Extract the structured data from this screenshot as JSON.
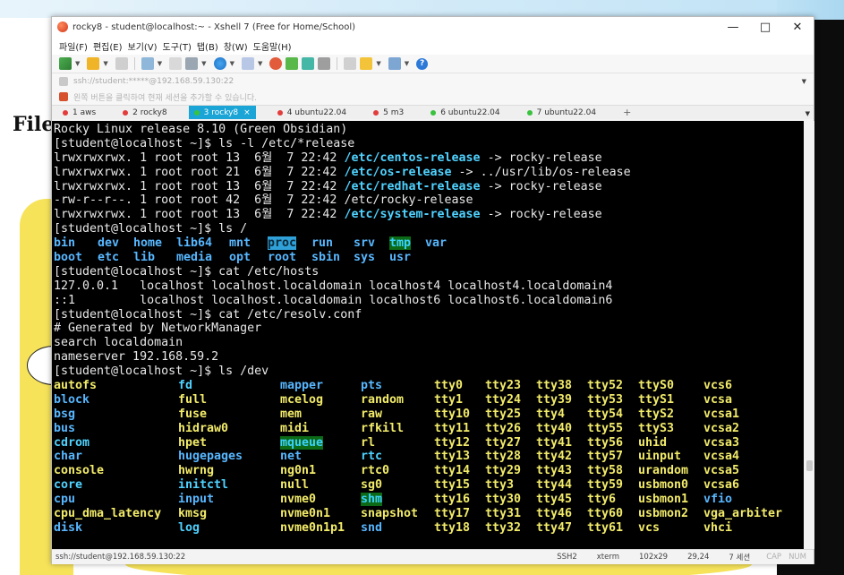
{
  "window": {
    "title": "rocky8 - student@localhost:~ - Xshell 7 (Free for Home/School)"
  },
  "background": {
    "title_fragment": "File"
  },
  "menubar": {
    "items": [
      "파일(F)",
      "편집(E)",
      "보기(V)",
      "도구(T)",
      "탭(B)",
      "창(W)",
      "도움말(H)"
    ]
  },
  "addressbar": {
    "text": "ssh://student:*****@192.168.59.130:22"
  },
  "infobar": {
    "text": "왼쪽 버튼을 클릭하여 현재 세션을 추가할 수 있습니다."
  },
  "tabs": [
    {
      "label": "1 aws",
      "color": "#e23c3c"
    },
    {
      "label": "2 rocky8",
      "color": "#e23c3c"
    },
    {
      "label": "3 rocky8",
      "color": "#38c23d",
      "active": true
    },
    {
      "label": "4 ubuntu22.04",
      "color": "#e23c3c"
    },
    {
      "label": "5 m3",
      "color": "#e23c3c"
    },
    {
      "label": "6 ubuntu22.04",
      "color": "#38c23d"
    },
    {
      "label": "7 ubuntu22.04",
      "color": "#38c23d"
    }
  ],
  "tab_add": "+",
  "terminal": {
    "line0": "Rocky Linux release 8.10 (Green Obsidian)",
    "cmd1": "[student@localhost ~]$ ls -l /etc/*release",
    "rel": [
      {
        "prefix": "lrwxrwxrwx. 1 root root 13  6월  7 22:42 ",
        "name": "/etc/centos-release",
        "suffix": " -> rocky-release",
        "link": true
      },
      {
        "prefix": "lrwxrwxrwx. 1 root root 21  6월  7 22:42 ",
        "name": "/etc/os-release",
        "suffix": " -> ../usr/lib/os-release",
        "link": true
      },
      {
        "prefix": "lrwxrwxrwx. 1 root root 13  6월  7 22:42 ",
        "name": "/etc/redhat-release",
        "suffix": " -> rocky-release",
        "link": true
      },
      {
        "prefix": "-rw-r--r--. 1 root root 42  6월  7 22:42 ",
        "name": "/etc/rocky-release",
        "suffix": "",
        "link": false
      },
      {
        "prefix": "lrwxrwxrwx. 1 root root 13  6월  7 22:42 ",
        "name": "/etc/system-release",
        "suffix": " -> rocky-release",
        "link": true
      }
    ],
    "cmd2": "[student@localhost ~]$ ls /",
    "root_row1": [
      "bin",
      "dev",
      "home",
      "lib64",
      "mnt",
      "proc",
      "run",
      "srv",
      "tmp",
      "var"
    ],
    "root_row2": [
      "boot",
      "etc",
      "lib",
      "media",
      "opt",
      "root",
      "sbin",
      "sys",
      "usr"
    ],
    "cmd3": "[student@localhost ~]$ cat /etc/hosts",
    "hosts1": "127.0.0.1   localhost localhost.localdomain localhost4 localhost4.localdomain4",
    "hosts2": "::1         localhost localhost.localdomain localhost6 localhost6.localdomain6",
    "cmd4": "[student@localhost ~]$ cat /etc/resolv.conf",
    "resolv1": "# Generated by NetworkManager",
    "resolv2": "search localdomain",
    "resolv3": "nameserver 192.168.59.2",
    "cmd5": "[student@localhost ~]$ ls /dev",
    "dev_rows": [
      [
        "autofs",
        "fd",
        "mapper",
        "pts",
        "tty0",
        "tty23",
        "tty38",
        "tty52",
        "ttyS0",
        "vcs6"
      ],
      [
        "block",
        "full",
        "mcelog",
        "random",
        "tty1",
        "tty24",
        "tty39",
        "tty53",
        "ttyS1",
        "vcsa"
      ],
      [
        "bsg",
        "fuse",
        "mem",
        "raw",
        "tty10",
        "tty25",
        "tty4",
        "tty54",
        "ttyS2",
        "vcsa1"
      ],
      [
        "bus",
        "hidraw0",
        "midi",
        "rfkill",
        "tty11",
        "tty26",
        "tty40",
        "tty55",
        "ttyS3",
        "vcsa2"
      ],
      [
        "cdrom",
        "hpet",
        "mqueue",
        "rl",
        "tty12",
        "tty27",
        "tty41",
        "tty56",
        "uhid",
        "vcsa3"
      ],
      [
        "char",
        "hugepages",
        "net",
        "rtc",
        "tty13",
        "tty28",
        "tty42",
        "tty57",
        "uinput",
        "vcsa4"
      ],
      [
        "console",
        "hwrng",
        "ng0n1",
        "rtc0",
        "tty14",
        "tty29",
        "tty43",
        "tty58",
        "urandom",
        "vcsa5"
      ],
      [
        "core",
        "initctl",
        "null",
        "sg0",
        "tty15",
        "tty3",
        "tty44",
        "tty59",
        "usbmon0",
        "vcsa6"
      ],
      [
        "cpu",
        "input",
        "nvme0",
        "shm",
        "tty16",
        "tty30",
        "tty45",
        "tty6",
        "usbmon1",
        "vfio"
      ],
      [
        "cpu_dma_latency",
        "kmsg",
        "nvme0n1",
        "snapshot",
        "tty17",
        "tty31",
        "tty46",
        "tty60",
        "usbmon2",
        "vga_arbiter"
      ],
      [
        "disk",
        "log",
        "nvme0n1p1",
        "snd",
        "tty18",
        "tty32",
        "tty47",
        "tty61",
        "vcs",
        "vhci"
      ]
    ]
  },
  "statusbar": {
    "connection": "ssh://student@192.168.59.130:22",
    "protocol": "SSH2",
    "term": "xterm",
    "size": "102x29",
    "pos": "29,24",
    "sessions": "7 세션",
    "caps": "CAP",
    "num": "NUM"
  },
  "colors": {
    "terminal_bg": "#000000",
    "dir_blue": "#57b7ff",
    "link_cyan": "#4fd2ff",
    "device_yellow": "#f2eb6a",
    "active_tab": "#1aa5d6"
  }
}
